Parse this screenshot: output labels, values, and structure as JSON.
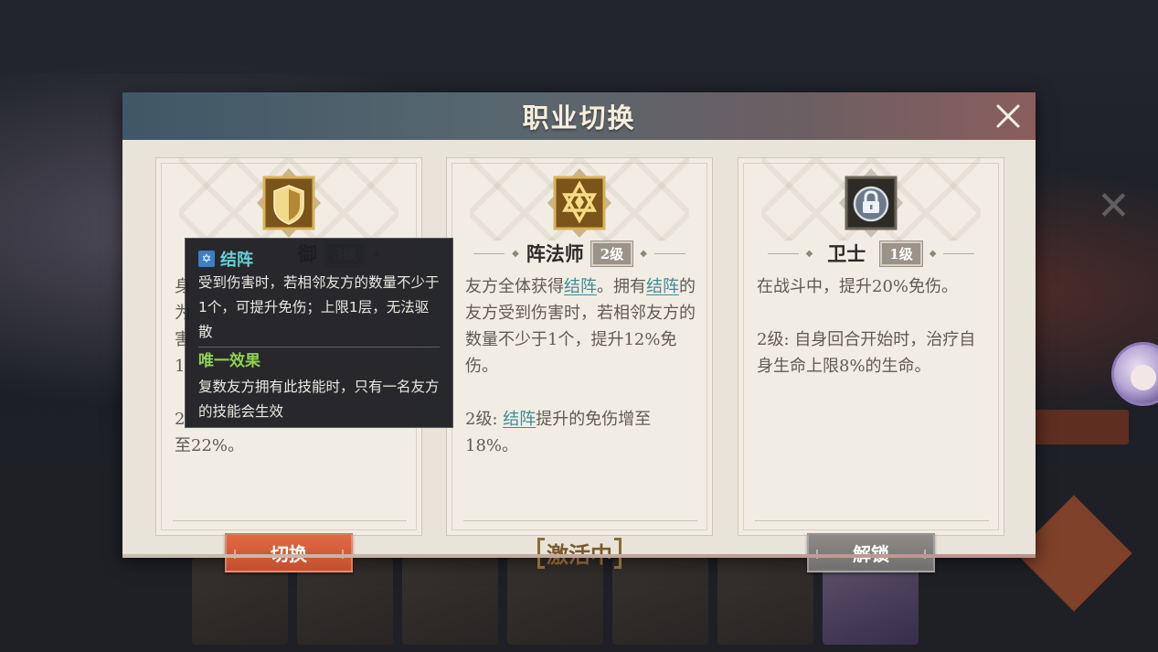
{
  "modal": {
    "title": "职业切换",
    "close_icon": "close-x-icon"
  },
  "cards": [
    {
      "icon": "shield-icon",
      "name": "御",
      "level": "3级",
      "desc_visible_1": "身",
      "desc_visible_2": "为",
      "desc_visible_3": "害",
      "desc_visible_4": "1",
      "desc_visible_5": "2",
      "desc_tail": "至22%。",
      "button_label": "切换",
      "button_style": "switch"
    },
    {
      "icon": "hexagram-icon",
      "name": "阵法师",
      "level": "2级",
      "desc_p1_a": "友方全体获得",
      "desc_p1_link1": "结阵",
      "desc_p1_b": "。拥有",
      "desc_p1_link2": "结阵",
      "desc_p1_c": "的友方受到伤害时，若相邻友方的数量不少于1个，提升12%免伤。",
      "desc_p2_a": "2级: ",
      "desc_p2_link": "结阵",
      "desc_p2_b": "提升的免伤增至18%。",
      "button_label": "激活中",
      "button_style": "active"
    },
    {
      "icon": "lock-icon",
      "name": "卫士",
      "level": "1级",
      "desc_p1": "在战斗中，提升20%免伤。",
      "desc_p2": "2级: 自身回合开始时，治疗自身生命上限8%的生命。",
      "button_label": "解锁",
      "button_style": "unlock"
    }
  ],
  "tooltip": {
    "icon": "formation-star-icon",
    "title": "结阵",
    "text": "受到伤害时，若相邻友方的数量不少于1个，可提升免伤；上限1层，无法驱散",
    "subtitle": "唯一效果",
    "subtext": "复数友方拥有此技能时，只有一名友方的技能会生效"
  },
  "colors": {
    "accent_link": "#3e8c93",
    "switch_button": "#d65a36",
    "tooltip_title": "#66cfd8",
    "tooltip_subtitle": "#8fd14f"
  }
}
